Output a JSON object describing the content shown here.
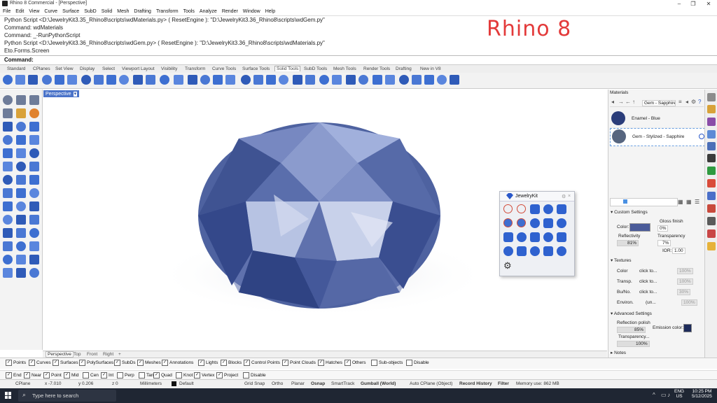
{
  "window": {
    "title": "Rhino 8 Commercial - [Perspective]"
  },
  "menu": [
    "File",
    "Edit",
    "View",
    "Curve",
    "Surface",
    "SubD",
    "Solid",
    "Mesh",
    "Drafting",
    "Transform",
    "Tools",
    "Analyze",
    "Render",
    "Window",
    "Help"
  ],
  "command_history": [
    "Python Script <D:\\JewelryKit3.35_Rhino8\\scripts\\wdMaterials.py> ( ResetEngine ): \"D:\\JewelryKit3.36_Rhino8\\scripts\\wdGem.py\"",
    "Command: wdMaterials",
    "Command: _-RunPythonScript",
    "Python Script <D:\\JewelryKit3.36_Rhino8\\scripts\\wdGem.py> ( ResetEngine ): \"D:\\JewelryKit3.36_Rhino8\\scripts\\wdMaterials.py\"",
    "Eto.Forms.Screen"
  ],
  "annotation": "Rhino 8",
  "command_prompt": "Command:",
  "toolbar_tabs": [
    "Standard",
    "CPlanes",
    "Set View",
    "Display",
    "Select",
    "Viewport Layout",
    "Visibility",
    "Transform",
    "Curve Tools",
    "Surface Tools",
    "Solid Tools",
    "SubD Tools",
    "Mesh Tools",
    "Render Tools",
    "Drafting",
    "New in V8"
  ],
  "active_toolbar_tab": "Solid Tools",
  "viewport": {
    "label": "Perspective",
    "tabs": [
      "Perspective",
      "Top",
      "Front",
      "Right"
    ],
    "add_tab": "+"
  },
  "jewelrykit": {
    "title": "JewelryKit"
  },
  "materials_panel": {
    "title": "Materials",
    "breadcrumb": "Gem - Sapphire",
    "items": [
      {
        "name": "Enamel - Blue"
      },
      {
        "name": "Gem - Stylized - Sapphire"
      }
    ],
    "custom_settings": {
      "header": "Custom Settings",
      "color_label": "Color:",
      "color_value": "#4a5b99",
      "gloss_label": "Gloss finish",
      "gloss_value": "0%",
      "reflectivity_label": "Reflectivity",
      "reflectivity_value": "81%",
      "transparency_label": "Transparency",
      "transparency_value": "7%",
      "ior_label": "IOR:",
      "ior_value": "1.00"
    },
    "textures": {
      "header": "Textures",
      "rows": [
        {
          "label": "Color",
          "value": "click to...",
          "amount": "100%"
        },
        {
          "label": "Transp.",
          "value": "click to...",
          "amount": "100%"
        },
        {
          "label": "Bu/No.",
          "value": "click to...",
          "amount": "30%"
        },
        {
          "label": "Environ.",
          "value": "(un...",
          "amount": "100%"
        }
      ]
    },
    "advanced": {
      "header": "Advanced Settings",
      "reflection_polish_label": "Reflection polish",
      "reflection_polish_value": "85%",
      "emission_label": "Emission color:",
      "transparency_label": "Transparency...",
      "transparency_value": "100%"
    },
    "notes_header": "Notes"
  },
  "osnap_filters": [
    {
      "label": "Points",
      "checked": true
    },
    {
      "label": "Curves",
      "checked": true
    },
    {
      "label": "Surfaces",
      "checked": true
    },
    {
      "label": "PolySurfaces",
      "checked": true
    },
    {
      "label": "SubDs",
      "checked": true
    },
    {
      "label": "Meshes",
      "checked": true
    },
    {
      "label": "Annotations",
      "checked": true
    },
    {
      "label": "Lights",
      "checked": true
    },
    {
      "label": "Blocks",
      "checked": true
    },
    {
      "label": "Control Points",
      "checked": true
    },
    {
      "label": "Point Clouds",
      "checked": true
    },
    {
      "label": "Hatches",
      "checked": true
    },
    {
      "label": "Others",
      "checked": true
    },
    {
      "label": "Sub-objects",
      "checked": false
    },
    {
      "label": "Disable",
      "checked": false
    }
  ],
  "osnaps": [
    {
      "label": "End",
      "checked": true
    },
    {
      "label": "Near",
      "checked": true
    },
    {
      "label": "Point",
      "checked": true
    },
    {
      "label": "Mid",
      "checked": true
    },
    {
      "label": "Cen",
      "checked": false
    },
    {
      "label": "Int",
      "checked": true
    },
    {
      "label": "Perp",
      "checked": false
    },
    {
      "label": "Tan",
      "checked": false
    },
    {
      "label": "Quad",
      "checked": true
    },
    {
      "label": "Knot",
      "checked": false
    },
    {
      "label": "Vertex",
      "checked": true
    },
    {
      "label": "Project",
      "checked": true
    },
    {
      "label": "Disable",
      "checked": false
    }
  ],
  "status_bar": {
    "cplane": "CPlane",
    "x": "x -7.010",
    "y": "y 0.206",
    "z": "z 0",
    "units": "Millimeters",
    "layer": "Default",
    "grid_snap": "Grid Snap",
    "ortho": "Ortho",
    "planar": "Planar",
    "osnap": "Osnap",
    "smarttrack": "SmartTrack",
    "gumball": "Gumball (World)",
    "auto_cplane": "Auto CPlane (Object)",
    "record_history": "Record History",
    "filter": "Filter",
    "memory": "Memory use: 862 MB"
  },
  "taskbar": {
    "search_placeholder": "Type here to search",
    "lang": "ENG",
    "region": "US",
    "time": "10:25 PM",
    "date": "5/12/2025"
  },
  "colors": {
    "gem": "#5a6ea8",
    "accent": "#4a73c9",
    "annotation": "#e33a3a"
  }
}
